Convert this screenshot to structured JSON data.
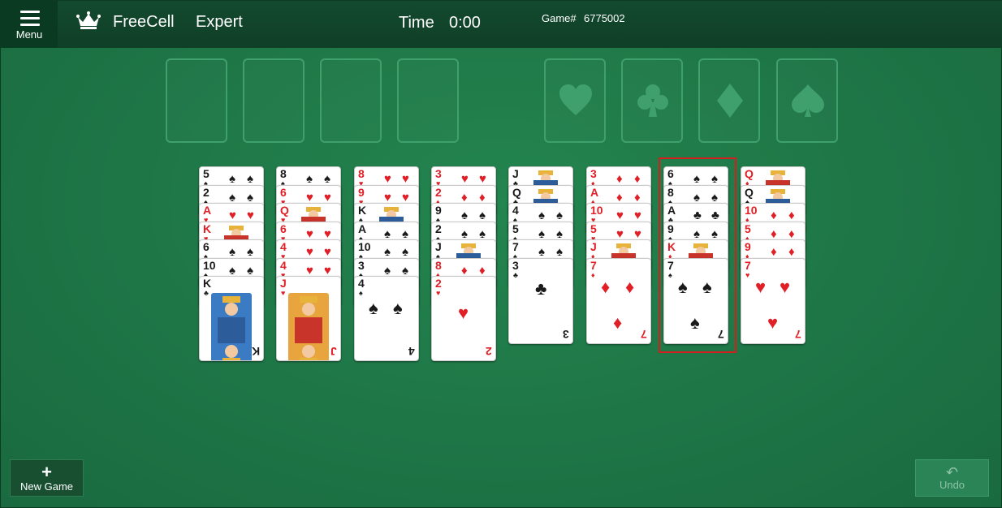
{
  "header": {
    "menu_label": "Menu",
    "app_title": "FreeCell",
    "mode": "Expert",
    "time_label": "Time",
    "time_value": "0:00",
    "game_label": "Game#",
    "game_number": "6775002"
  },
  "foundations": [
    "heart",
    "club",
    "diamond",
    "spade"
  ],
  "colors": {
    "felt": "#1f7a4a",
    "red_suit": "#e01f26",
    "black_suit": "#1a1a1a",
    "selection": "#d41f1f"
  },
  "tableau": [
    {
      "cards": [
        [
          "5",
          "♠"
        ],
        [
          "2",
          "♠"
        ],
        [
          "A",
          "♥"
        ],
        [
          "K",
          "♥"
        ],
        [
          "6",
          "♠"
        ],
        [
          "10",
          "♠"
        ],
        [
          "K",
          "♣"
        ]
      ]
    },
    {
      "cards": [
        [
          "8",
          "♠"
        ],
        [
          "6",
          "♥"
        ],
        [
          "Q",
          "♥"
        ],
        [
          "6",
          "♥"
        ],
        [
          "4",
          "♥"
        ],
        [
          "4",
          "♥"
        ],
        [
          "J",
          "♥"
        ]
      ]
    },
    {
      "cards": [
        [
          "8",
          "♥"
        ],
        [
          "9",
          "♥"
        ],
        [
          "K",
          "♠"
        ],
        [
          "A",
          "♠"
        ],
        [
          "10",
          "♠"
        ],
        [
          "3",
          "♠"
        ],
        [
          "4",
          "♠"
        ]
      ]
    },
    {
      "cards": [
        [
          "3",
          "♥"
        ],
        [
          "2",
          "♦"
        ],
        [
          "9",
          "♠"
        ],
        [
          "2",
          "♠"
        ],
        [
          "J",
          "♠"
        ],
        [
          "8",
          "♦"
        ],
        [
          "2",
          "♥"
        ]
      ]
    },
    {
      "cards": [
        [
          "J",
          "♣"
        ],
        [
          "Q",
          "♣"
        ],
        [
          "4",
          "♠"
        ],
        [
          "5",
          "♠"
        ],
        [
          "7",
          "♠"
        ],
        [
          "3",
          "♣"
        ]
      ]
    },
    {
      "cards": [
        [
          "3",
          "♦"
        ],
        [
          "A",
          "♦"
        ],
        [
          "10",
          "♥"
        ],
        [
          "5",
          "♥"
        ],
        [
          "J",
          "♦"
        ],
        [
          "7",
          "♦"
        ]
      ]
    },
    {
      "cards": [
        [
          "6",
          "♠"
        ],
        [
          "8",
          "♠"
        ],
        [
          "A",
          "♣"
        ],
        [
          "9",
          "♠"
        ],
        [
          "K",
          "♦"
        ],
        [
          "7",
          "♠"
        ]
      ],
      "selected": true
    },
    {
      "cards": [
        [
          "Q",
          "♦"
        ],
        [
          "Q",
          "♠"
        ],
        [
          "10",
          "♦"
        ],
        [
          "5",
          "♦"
        ],
        [
          "9",
          "♦"
        ],
        [
          "7",
          "♥"
        ]
      ]
    }
  ],
  "footer": {
    "new_game_label": "New Game",
    "undo_label": "Undo"
  }
}
